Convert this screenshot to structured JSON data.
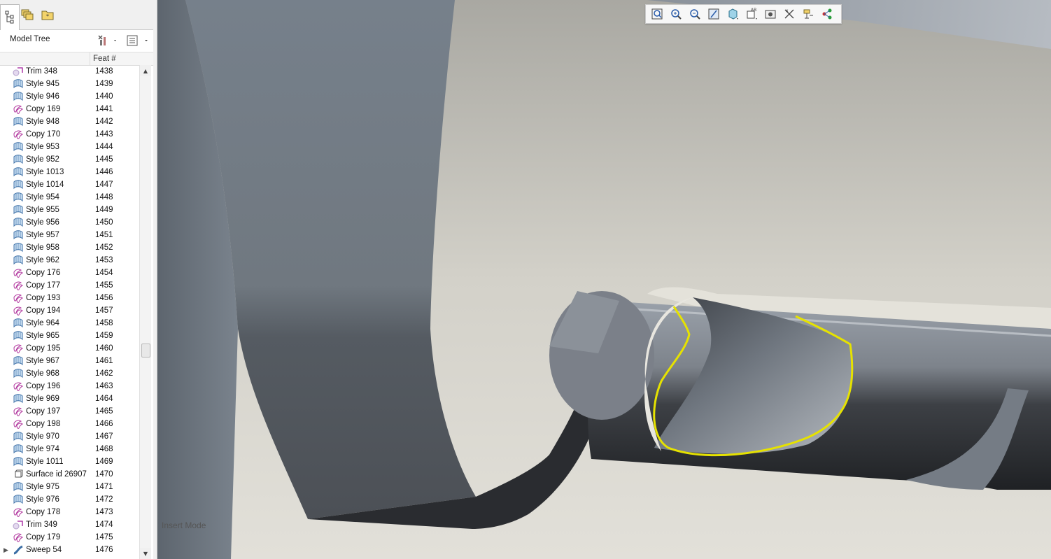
{
  "sidebar": {
    "tabs": [
      {
        "icon": "model-tree-icon"
      },
      {
        "icon": "layers-icon"
      },
      {
        "icon": "favorites-folder-icon"
      }
    ],
    "title": "Model Tree",
    "settings_icon": "tree-settings-icon",
    "columns_icon": "show-columns-icon",
    "column_feat": "Feat #",
    "rows": [
      {
        "type": "trim",
        "name": "Trim 348",
        "feat": "1438"
      },
      {
        "type": "style",
        "name": "Style 945",
        "feat": "1439"
      },
      {
        "type": "style",
        "name": "Style 946",
        "feat": "1440"
      },
      {
        "type": "copy",
        "name": "Copy 169",
        "feat": "1441"
      },
      {
        "type": "style",
        "name": "Style 948",
        "feat": "1442"
      },
      {
        "type": "copy",
        "name": "Copy 170",
        "feat": "1443"
      },
      {
        "type": "style",
        "name": "Style 953",
        "feat": "1444"
      },
      {
        "type": "style",
        "name": "Style 952",
        "feat": "1445"
      },
      {
        "type": "style",
        "name": "Style 1013",
        "feat": "1446"
      },
      {
        "type": "style",
        "name": "Style 1014",
        "feat": "1447"
      },
      {
        "type": "style",
        "name": "Style 954",
        "feat": "1448"
      },
      {
        "type": "style",
        "name": "Style 955",
        "feat": "1449"
      },
      {
        "type": "style",
        "name": "Style 956",
        "feat": "1450"
      },
      {
        "type": "style",
        "name": "Style 957",
        "feat": "1451"
      },
      {
        "type": "style",
        "name": "Style 958",
        "feat": "1452"
      },
      {
        "type": "style",
        "name": "Style 962",
        "feat": "1453"
      },
      {
        "type": "copy",
        "name": "Copy 176",
        "feat": "1454"
      },
      {
        "type": "copy",
        "name": "Copy 177",
        "feat": "1455"
      },
      {
        "type": "copy",
        "name": "Copy 193",
        "feat": "1456"
      },
      {
        "type": "copy",
        "name": "Copy 194",
        "feat": "1457"
      },
      {
        "type": "style",
        "name": "Style 964",
        "feat": "1458"
      },
      {
        "type": "style",
        "name": "Style 965",
        "feat": "1459"
      },
      {
        "type": "copy",
        "name": "Copy 195",
        "feat": "1460"
      },
      {
        "type": "style",
        "name": "Style 967",
        "feat": "1461"
      },
      {
        "type": "style",
        "name": "Style 968",
        "feat": "1462"
      },
      {
        "type": "copy",
        "name": "Copy 196",
        "feat": "1463"
      },
      {
        "type": "style",
        "name": "Style 969",
        "feat": "1464"
      },
      {
        "type": "copy",
        "name": "Copy 197",
        "feat": "1465"
      },
      {
        "type": "copy",
        "name": "Copy 198",
        "feat": "1466"
      },
      {
        "type": "style",
        "name": "Style 970",
        "feat": "1467"
      },
      {
        "type": "style",
        "name": "Style 974",
        "feat": "1468"
      },
      {
        "type": "style",
        "name": "Style 1011",
        "feat": "1469"
      },
      {
        "type": "surface",
        "name": "Surface id 26907",
        "feat": "1470"
      },
      {
        "type": "style",
        "name": "Style 975",
        "feat": "1471"
      },
      {
        "type": "style",
        "name": "Style 976",
        "feat": "1472"
      },
      {
        "type": "copy",
        "name": "Copy 178",
        "feat": "1473"
      },
      {
        "type": "trim",
        "name": "Trim 349",
        "feat": "1474"
      },
      {
        "type": "copy",
        "name": "Copy 179",
        "feat": "1475"
      },
      {
        "type": "sweep",
        "name": "Sweep 54",
        "feat": "1476",
        "expandable": true
      }
    ]
  },
  "view_toolbar": {
    "buttons": [
      {
        "name": "refit-icon"
      },
      {
        "name": "zoom-in-icon"
      },
      {
        "name": "zoom-out-icon"
      },
      {
        "name": "repaint-icon"
      },
      {
        "name": "display-style-icon"
      },
      {
        "name": "saved-views-icon"
      },
      {
        "name": "perspective-icon"
      },
      {
        "name": "datum-display-icon"
      },
      {
        "name": "annotation-display-icon"
      },
      {
        "name": "spin-center-icon"
      }
    ]
  },
  "status": {
    "mode": "Insert Mode"
  },
  "colors": {
    "background": "#dcdad3",
    "surface_dark": "#2a2c30",
    "surface_mid": "#7a8089",
    "surface_light": "#a8adb3",
    "highlight_curve": "#e6e200"
  }
}
